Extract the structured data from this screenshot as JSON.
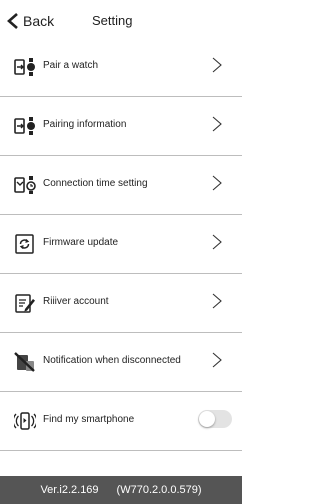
{
  "header": {
    "back_label": "Back",
    "title": "Setting"
  },
  "menu": [
    {
      "label": "Pair a watch",
      "icon": "pair-watch-icon"
    },
    {
      "label": "Pairing information",
      "icon": "pairing-info-icon"
    },
    {
      "label": "Connection time setting",
      "icon": "connection-time-icon"
    },
    {
      "label": "Firmware update",
      "icon": "firmware-update-icon"
    },
    {
      "label": "Riiiver account",
      "icon": "riiiver-account-icon"
    },
    {
      "label": "Notification when disconnected",
      "icon": "notification-disconnected-icon"
    },
    {
      "label": "Find my smartphone",
      "icon": "find-smartphone-icon",
      "toggle_on": false
    }
  ],
  "footer": {
    "app_version": "Ver.i2.2.169",
    "watch_version": "(W770.2.0.0.579)"
  },
  "colors": {
    "footer_bg": "#555555",
    "divider": "#bdbdbd",
    "toggle_off": "#e3e3e3"
  }
}
